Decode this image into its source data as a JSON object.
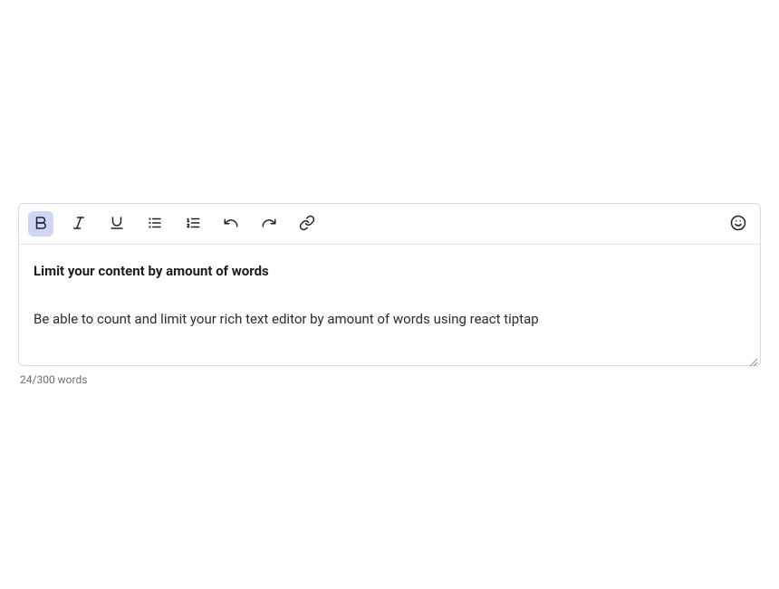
{
  "content": {
    "heading": "Limit your content by amount of words",
    "body": "Be able to count and limit your rich text editor by amount of words using react tiptap"
  },
  "word_counter": {
    "current": "24",
    "separator": "/",
    "limit": "300",
    "unit": " words"
  }
}
